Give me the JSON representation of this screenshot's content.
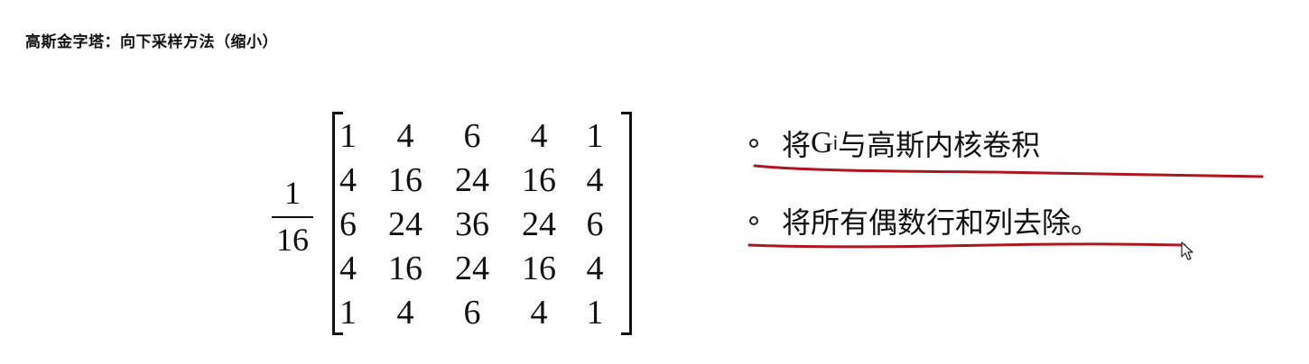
{
  "title": "高斯金字塔：向下采样方法（缩小）",
  "fraction": {
    "numerator": "1",
    "denominator": "16"
  },
  "matrix": {
    "rows": [
      [
        "1",
        "4",
        "6",
        "4",
        "1"
      ],
      [
        "4",
        "16",
        "24",
        "16",
        "4"
      ],
      [
        "6",
        "24",
        "36",
        "24",
        "6"
      ],
      [
        "4",
        "16",
        "24",
        "16",
        "4"
      ],
      [
        "1",
        "4",
        "6",
        "4",
        "1"
      ]
    ]
  },
  "bullets": {
    "first": {
      "prefix": "将 ",
      "symbol": "G",
      "subscript": "i",
      "suffix": " 与高斯内核卷积"
    },
    "second": {
      "text": "将所有偶数行和列去除。"
    }
  },
  "colors": {
    "underline": "#b0141e",
    "text": "#111111"
  },
  "icons": {
    "bullet": "hollow-circle",
    "cursor": "mouse-pointer-icon"
  }
}
